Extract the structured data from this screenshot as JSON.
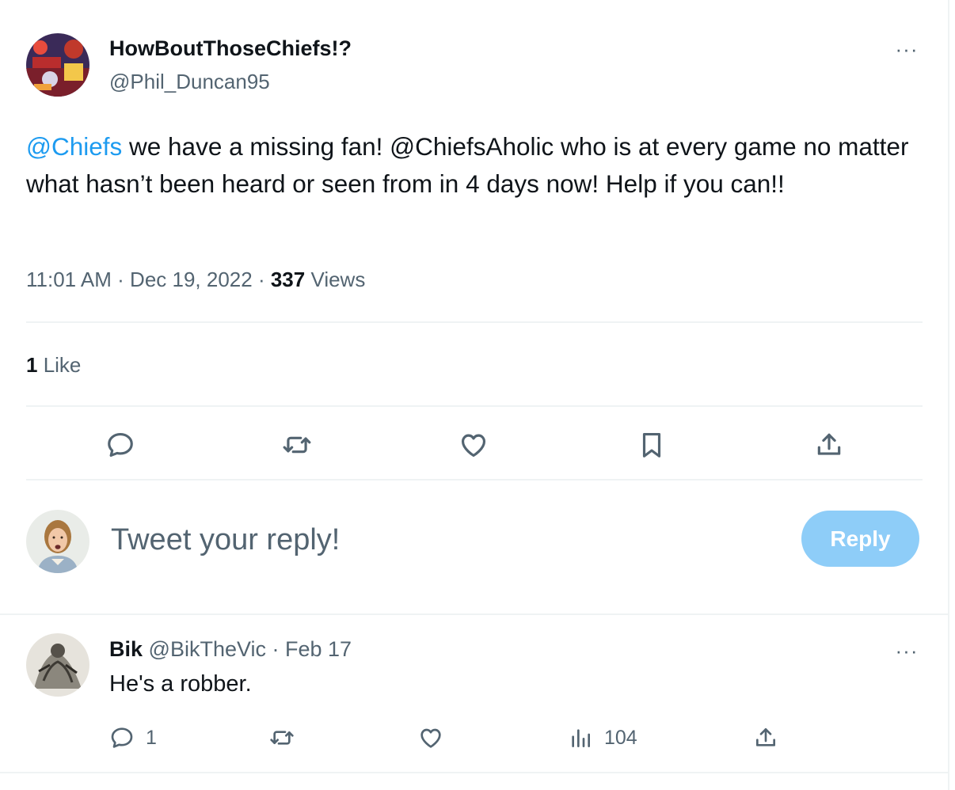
{
  "tweet": {
    "author_name": "HowBoutThoseChiefs!?",
    "author_handle": "@Phil_Duncan95",
    "more_label": "···",
    "text_mention": "@Chiefs",
    "text_body": " we have a missing fan! @ChiefsAholic who is at every game no matter what hasn’t been heard or seen from in 4 days now! Help if you can!!",
    "time": "11:01 AM",
    "sep1": " · ",
    "date": "Dec 19, 2022",
    "sep2": " · ",
    "views_count": "337",
    "views_label": " Views",
    "likes_count": "1",
    "likes_label": " Like",
    "icons": [
      "reply-icon",
      "retweet-icon",
      "like-icon",
      "bookmark-icon",
      "share-icon"
    ]
  },
  "reply_box": {
    "placeholder": "Tweet your reply!",
    "button_label": "Reply",
    "button_color": "#8ecdf8"
  },
  "reply": {
    "author_name": "Bik",
    "author_handle": " @BikTheVic",
    "sep": " · ",
    "date": "Feb 17",
    "more_label": "···",
    "text": "He's a robber.",
    "reply_count": "1",
    "views_count": "104",
    "icons": [
      "reply-icon",
      "retweet-icon",
      "like-icon",
      "views-icon",
      "share-icon"
    ]
  },
  "colors": {
    "text": "#0f1419",
    "secondary": "#536471",
    "accent": "#1d9bf0",
    "divider": "#eff3f4"
  }
}
